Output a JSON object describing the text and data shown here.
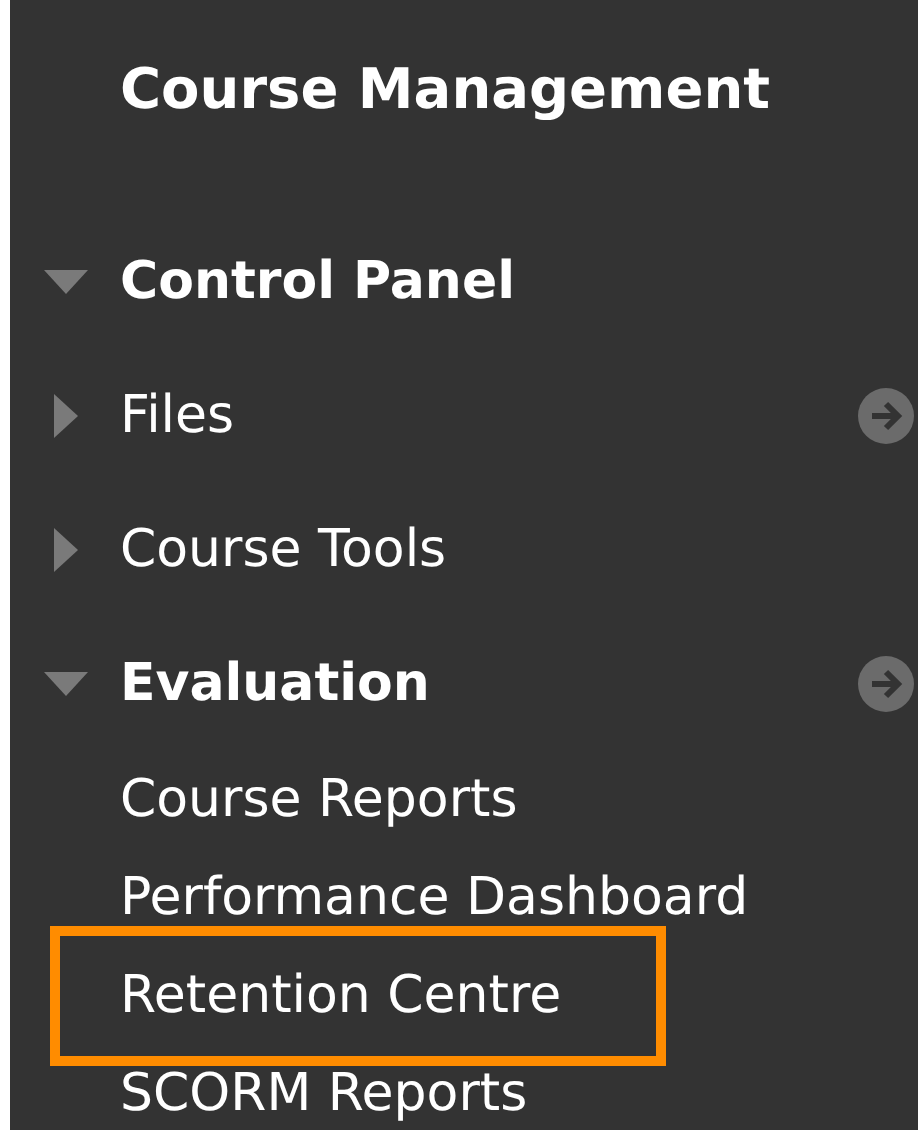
{
  "title": "Course Management",
  "control_panel": {
    "label": "Control Panel",
    "expanded": true,
    "children": [
      {
        "label": "Files",
        "expanded": false,
        "has_link": true
      },
      {
        "label": "Course Tools",
        "expanded": false,
        "has_link": false
      },
      {
        "label": "Evaluation",
        "expanded": true,
        "has_link": true,
        "children": [
          {
            "label": "Course Reports",
            "highlighted": false
          },
          {
            "label": "Performance Dashboard",
            "highlighted": false
          },
          {
            "label": "Retention Centre",
            "highlighted": true
          },
          {
            "label": "SCORM Reports",
            "highlighted": false
          }
        ]
      }
    ]
  }
}
